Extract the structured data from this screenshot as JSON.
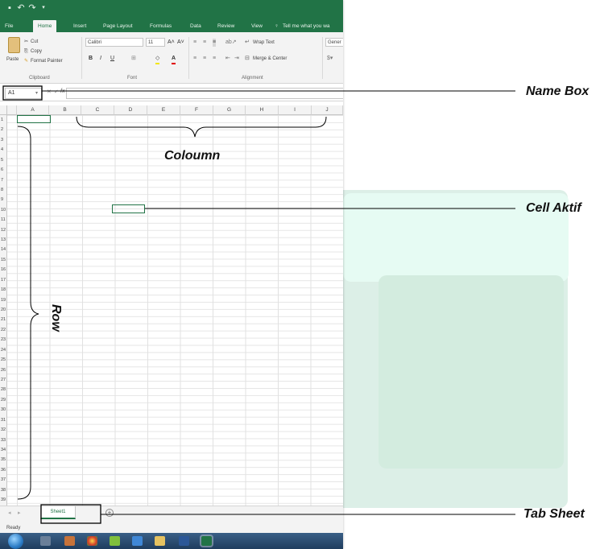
{
  "window": {
    "tabs": [
      "File",
      "Home",
      "Insert",
      "Page Layout",
      "Formulas",
      "Data",
      "Review",
      "View"
    ],
    "active_tab": "Home",
    "tell_me": "Tell me what you wa",
    "ribbon": {
      "paste": "Paste",
      "cut": "Cut",
      "copy": "Copy",
      "format_painter": "Format Painter",
      "clipboard_label": "Clipboard",
      "font_name": "Calibri",
      "font_size": "11",
      "font_label": "Font",
      "bold": "B",
      "italic": "I",
      "underline": "U",
      "wrap_text": "Wrap Text",
      "merge_center": "Merge & Center",
      "alignment_label": "Alignment",
      "number_format": "Gener"
    },
    "formula_bar": {
      "name_box": "A1",
      "fx": "fx"
    },
    "columns": [
      "A",
      "B",
      "C",
      "D",
      "E",
      "F",
      "G",
      "H",
      "I",
      "J"
    ],
    "rows": [
      "1",
      "2",
      "3",
      "4",
      "5",
      "6",
      "7",
      "8",
      "9",
      "10",
      "11",
      "12",
      "13",
      "14",
      "15",
      "16",
      "17",
      "18",
      "19",
      "20",
      "21",
      "22",
      "23",
      "24",
      "25",
      "26",
      "27",
      "28",
      "29",
      "30",
      "31",
      "32",
      "33",
      "34",
      "35",
      "36",
      "37",
      "38",
      "39"
    ],
    "sheet_tab": "Sheet1",
    "status": "Ready"
  },
  "annotations": {
    "name_box": "Name Box",
    "column": "Coloumn",
    "active_cell": "Cell Aktif",
    "row": "Row",
    "tab_sheet": "Tab Sheet"
  },
  "colors": {
    "excel_green": "#217346",
    "background_mint": "#d8f5ea"
  }
}
